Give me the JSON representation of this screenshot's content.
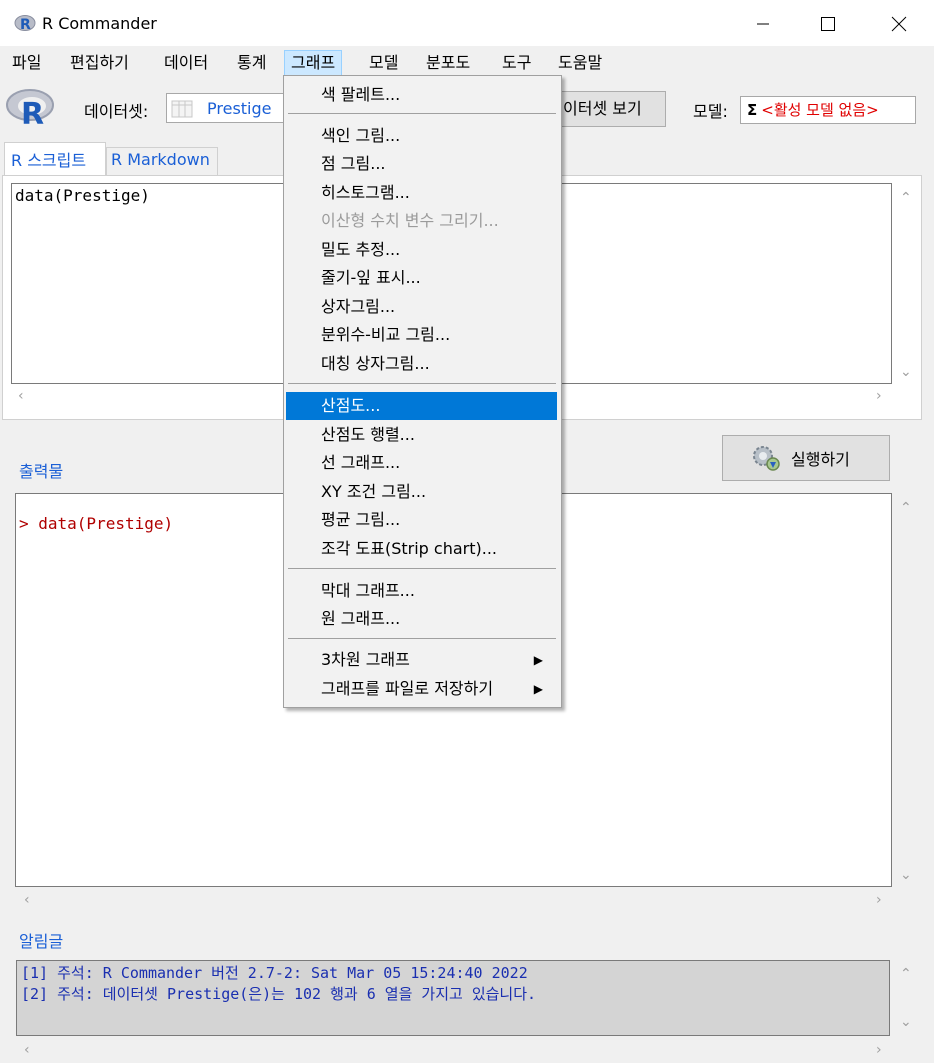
{
  "window": {
    "title": "R Commander"
  },
  "menubar": {
    "items": [
      "파일",
      "편집하기",
      "데이터",
      "통계",
      "그래프",
      "모델",
      "분포도",
      "도구",
      "도움말"
    ],
    "active_index": 4
  },
  "toolbar": {
    "dataset_label": "데이터셋:",
    "dataset_value": "Prestige",
    "view_dataset_button": "이터셋 보기",
    "model_label": "모델:",
    "model_sigma": "Σ",
    "model_value": "<활성 모델 없음>"
  },
  "tabs": {
    "script": "R 스크립트",
    "markdown": "R Markdown"
  },
  "script": {
    "content": "data(Prestige)"
  },
  "output": {
    "label": "출력물",
    "run_button": "실행하기",
    "content": "> data(Prestige)"
  },
  "messages": {
    "label": "알림글",
    "lines": [
      "[1] 주석: R Commander 버전 2.7-2: Sat Mar 05 15:24:40 2022",
      "[2] 주석: 데이터셋 Prestige(은)는 102 행과 6 열을 가지고 있습니다."
    ]
  },
  "graph_menu": {
    "items": {
      "color_palette": "색 팔레트...",
      "index_plot": "색인 그림...",
      "dot_plot": "점 그림...",
      "histogram": "히스토그램...",
      "discrete_plot": "이산형 수치 변수 그리기...",
      "density": "밀도 추정...",
      "stem_leaf": "줄기-잎 표시...",
      "boxplot": "상자그림...",
      "qq_plot": "분위수-비교 그림...",
      "symbox": "대칭 상자그림...",
      "scatterplot": "산점도...",
      "scatter_matrix": "산점도 행렬...",
      "line_graph": "선 그래프...",
      "xy_conditioning": "XY 조건 그림...",
      "means_plot": "평균 그림...",
      "strip_chart": "조각 도표(Strip chart)...",
      "bar_graph": "막대 그래프...",
      "pie_chart": "원 그래프...",
      "3d_graph": "3차원 그래프",
      "save_graph": "그래프를 파일로 저장하기"
    }
  },
  "colors": {
    "accent_blue": "#1a5fd6",
    "menu_highlight": "#0078d7",
    "error_red": "#e00000",
    "output_red": "#b00000",
    "message_blue": "#1a2fb0"
  }
}
